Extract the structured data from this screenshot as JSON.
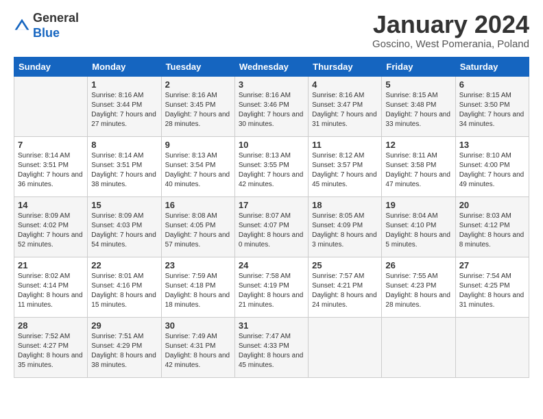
{
  "header": {
    "logo_general": "General",
    "logo_blue": "Blue",
    "month_title": "January 2024",
    "location": "Goscino, West Pomerania, Poland"
  },
  "days_of_week": [
    "Sunday",
    "Monday",
    "Tuesday",
    "Wednesday",
    "Thursday",
    "Friday",
    "Saturday"
  ],
  "weeks": [
    [
      {
        "day": "",
        "info": ""
      },
      {
        "day": "1",
        "info": "Sunrise: 8:16 AM\nSunset: 3:44 PM\nDaylight: 7 hours\nand 27 minutes."
      },
      {
        "day": "2",
        "info": "Sunrise: 8:16 AM\nSunset: 3:45 PM\nDaylight: 7 hours\nand 28 minutes."
      },
      {
        "day": "3",
        "info": "Sunrise: 8:16 AM\nSunset: 3:46 PM\nDaylight: 7 hours\nand 30 minutes."
      },
      {
        "day": "4",
        "info": "Sunrise: 8:16 AM\nSunset: 3:47 PM\nDaylight: 7 hours\nand 31 minutes."
      },
      {
        "day": "5",
        "info": "Sunrise: 8:15 AM\nSunset: 3:48 PM\nDaylight: 7 hours\nand 33 minutes."
      },
      {
        "day": "6",
        "info": "Sunrise: 8:15 AM\nSunset: 3:50 PM\nDaylight: 7 hours\nand 34 minutes."
      }
    ],
    [
      {
        "day": "7",
        "info": ""
      },
      {
        "day": "8",
        "info": "Sunrise: 8:14 AM\nSunset: 3:51 PM\nDaylight: 7 hours\nand 38 minutes."
      },
      {
        "day": "9",
        "info": "Sunrise: 8:13 AM\nSunset: 3:54 PM\nDaylight: 7 hours\nand 40 minutes."
      },
      {
        "day": "10",
        "info": "Sunrise: 8:13 AM\nSunset: 3:55 PM\nDaylight: 7 hours\nand 42 minutes."
      },
      {
        "day": "11",
        "info": "Sunrise: 8:12 AM\nSunset: 3:57 PM\nDaylight: 7 hours\nand 45 minutes."
      },
      {
        "day": "12",
        "info": "Sunrise: 8:11 AM\nSunset: 3:58 PM\nDaylight: 7 hours\nand 47 minutes."
      },
      {
        "day": "13",
        "info": "Sunrise: 8:10 AM\nSunset: 4:00 PM\nDaylight: 7 hours\nand 49 minutes."
      }
    ],
    [
      {
        "day": "14",
        "info": ""
      },
      {
        "day": "15",
        "info": "Sunrise: 8:09 AM\nSunset: 4:03 PM\nDaylight: 7 hours\nand 54 minutes."
      },
      {
        "day": "16",
        "info": "Sunrise: 8:08 AM\nSunset: 4:05 PM\nDaylight: 7 hours\nand 57 minutes."
      },
      {
        "day": "17",
        "info": "Sunrise: 8:07 AM\nSunset: 4:07 PM\nDaylight: 8 hours\nand 0 minutes."
      },
      {
        "day": "18",
        "info": "Sunrise: 8:05 AM\nSunset: 4:09 PM\nDaylight: 8 hours\nand 3 minutes."
      },
      {
        "day": "19",
        "info": "Sunrise: 8:04 AM\nSunset: 4:10 PM\nDaylight: 8 hours\nand 5 minutes."
      },
      {
        "day": "20",
        "info": "Sunrise: 8:03 AM\nSunset: 4:12 PM\nDaylight: 8 hours\nand 8 minutes."
      }
    ],
    [
      {
        "day": "21",
        "info": ""
      },
      {
        "day": "22",
        "info": "Sunrise: 8:01 AM\nSunset: 4:16 PM\nDaylight: 8 hours\nand 15 minutes."
      },
      {
        "day": "23",
        "info": "Sunrise: 7:59 AM\nSunset: 4:18 PM\nDaylight: 8 hours\nand 18 minutes."
      },
      {
        "day": "24",
        "info": "Sunrise: 7:58 AM\nSunset: 4:19 PM\nDaylight: 8 hours\nand 21 minutes."
      },
      {
        "day": "25",
        "info": "Sunrise: 7:57 AM\nSunset: 4:21 PM\nDaylight: 8 hours\nand 24 minutes."
      },
      {
        "day": "26",
        "info": "Sunrise: 7:55 AM\nSunset: 4:23 PM\nDaylight: 8 hours\nand 28 minutes."
      },
      {
        "day": "27",
        "info": "Sunrise: 7:54 AM\nSunset: 4:25 PM\nDaylight: 8 hours\nand 31 minutes."
      }
    ],
    [
      {
        "day": "28",
        "info": ""
      },
      {
        "day": "29",
        "info": "Sunrise: 7:51 AM\nSunset: 4:29 PM\nDaylight: 8 hours\nand 38 minutes."
      },
      {
        "day": "30",
        "info": "Sunrise: 7:49 AM\nSunset: 4:31 PM\nDaylight: 8 hours\nand 42 minutes."
      },
      {
        "day": "31",
        "info": "Sunrise: 7:47 AM\nSunset: 4:33 PM\nDaylight: 8 hours\nand 45 minutes."
      },
      {
        "day": "",
        "info": ""
      },
      {
        "day": "",
        "info": ""
      },
      {
        "day": "",
        "info": ""
      }
    ]
  ],
  "week1_day7_info": "Sunrise: 8:14 AM\nSunset: 3:51 PM\nDaylight: 7 hours\nand 36 minutes.",
  "week2_day14_info": "Sunrise: 8:09 AM\nSunset: 4:02 PM\nDaylight: 7 hours\nand 52 minutes.",
  "week3_day21_info": "Sunrise: 8:02 AM\nSunset: 4:14 PM\nDaylight: 8 hours\nand 11 minutes.",
  "week4_day28_info": "Sunrise: 7:52 AM\nSunset: 4:27 PM\nDaylight: 8 hours\nand 35 minutes."
}
